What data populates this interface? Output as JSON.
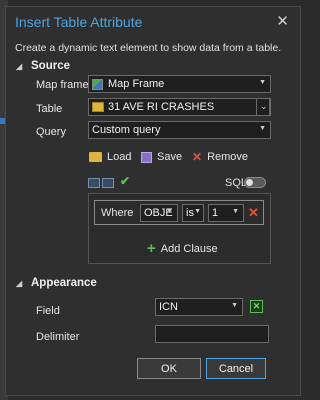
{
  "dialog": {
    "title": "Insert Table Attribute",
    "close_glyph": "✕",
    "description": "Create a dynamic text element to show data from a table."
  },
  "source": {
    "heading": "Source",
    "map_frame": {
      "label": "Map frame",
      "value": "Map Frame"
    },
    "table": {
      "label": "Table",
      "value": "31 AVE RI CRASHES"
    },
    "query": {
      "label": "Query",
      "value": "Custom query"
    },
    "toolbar": {
      "load": "Load",
      "save": "Save",
      "remove": "Remove"
    },
    "sql_label": "SQL",
    "sql_enabled": false,
    "clause": {
      "where_label": "Where",
      "field": "OBJE",
      "operator": "is",
      "value": "1"
    },
    "add_clause_label": "Add Clause"
  },
  "appearance": {
    "heading": "Appearance",
    "field": {
      "label": "Field",
      "value": "ICN"
    },
    "delimiter": {
      "label": "Delimiter",
      "value": ""
    }
  },
  "buttons": {
    "ok": "OK",
    "cancel": "Cancel"
  },
  "colors": {
    "accent": "#4fa3e0",
    "add": "#5bbf5b",
    "remove": "#e0523f"
  }
}
